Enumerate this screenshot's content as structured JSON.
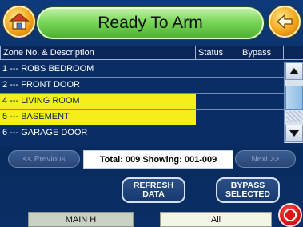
{
  "header": {
    "title": "Ready To Arm",
    "home_icon": "house-icon",
    "back_icon": "back-arrow-icon"
  },
  "table": {
    "columns": [
      "Zone No. & Description",
      "Status",
      "Bypass"
    ],
    "rows": [
      {
        "desc": "1 --- ROBS BEDROOM",
        "status": "",
        "bypass": "",
        "selected": false
      },
      {
        "desc": "2 --- FRONT DOOR",
        "status": "",
        "bypass": "",
        "selected": false
      },
      {
        "desc": "4 --- LIVING ROOM",
        "status": "",
        "bypass": "",
        "selected": true
      },
      {
        "desc": "5 --- BASEMENT",
        "status": "",
        "bypass": "",
        "selected": true
      },
      {
        "desc": "6 --- GARAGE DOOR",
        "status": "",
        "bypass": "",
        "selected": false
      }
    ]
  },
  "pager": {
    "prev_label": "<< Previous",
    "next_label": "Next >>",
    "info": "Total: 009  Showing: 001-009"
  },
  "actions": {
    "refresh_line1": "REFRESH",
    "refresh_line2": "DATA",
    "bypass_line1": "BYPASS",
    "bypass_line2": "SELECTED"
  },
  "footer": {
    "partition": "MAIN H",
    "filter": "All",
    "emergency_icon": "emergency-icon"
  },
  "colors": {
    "background": "#0b2a5e",
    "title_green": "#7ad65a",
    "selected_row": "#f4ee1a",
    "accent_orange": "#f3a51c",
    "emergency_red": "#e01414"
  }
}
